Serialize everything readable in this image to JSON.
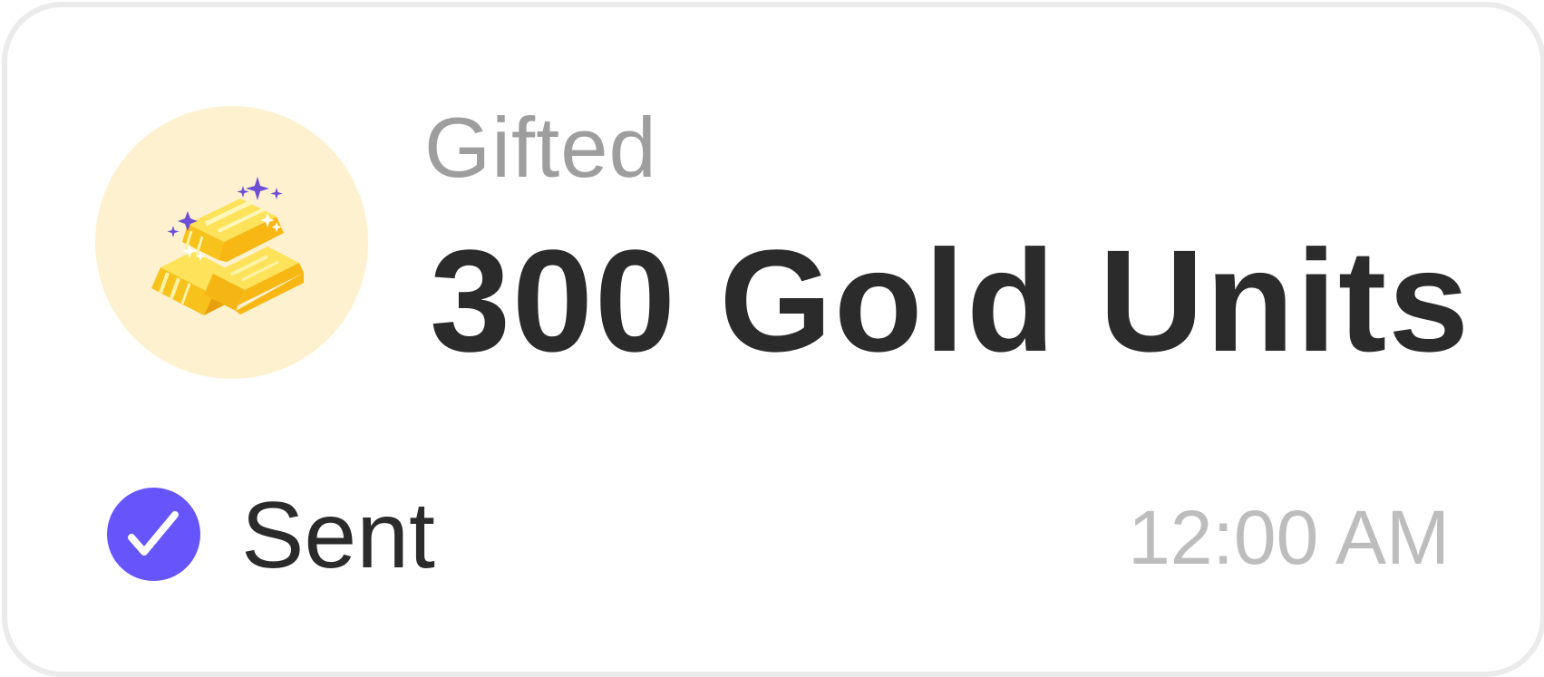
{
  "gift": {
    "label": "Gifted",
    "amount": "300 Gold Units",
    "icon": "gold-bars-icon"
  },
  "status": {
    "text": "Sent",
    "icon": "check-circle-icon"
  },
  "timestamp": "12:00 AM",
  "colors": {
    "icon_background": "#fef1cf",
    "gold": "#f9b714",
    "sparkle": "#6f4fd6",
    "check_badge": "#6655fb",
    "primary_text": "#2b2b2b",
    "secondary_text": "#9e9e9e",
    "time_text": "#bdbdbd",
    "card_border": "#ebebeb"
  }
}
